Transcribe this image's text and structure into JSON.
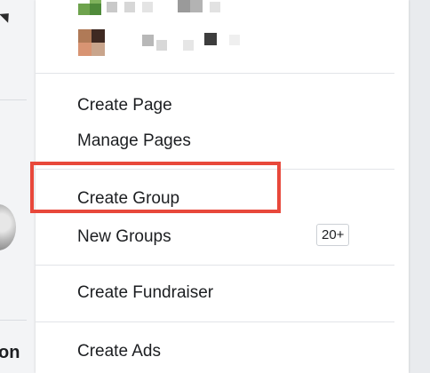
{
  "menu": {
    "pages": [
      {
        "label": "Create Page"
      },
      {
        "label": "Manage Pages"
      }
    ],
    "groups": [
      {
        "label": "Create Group",
        "highlighted": true
      },
      {
        "label": "New Groups",
        "badge": "20+"
      }
    ],
    "fundraisers": [
      {
        "label": "Create Fundraiser"
      }
    ],
    "ads": [
      {
        "label": "Create Ads"
      }
    ]
  },
  "background": {
    "partial_text": "on"
  },
  "colors": {
    "highlight_border": "#e8483b",
    "menu_background": "#ffffff",
    "text": "#1c1e21"
  }
}
